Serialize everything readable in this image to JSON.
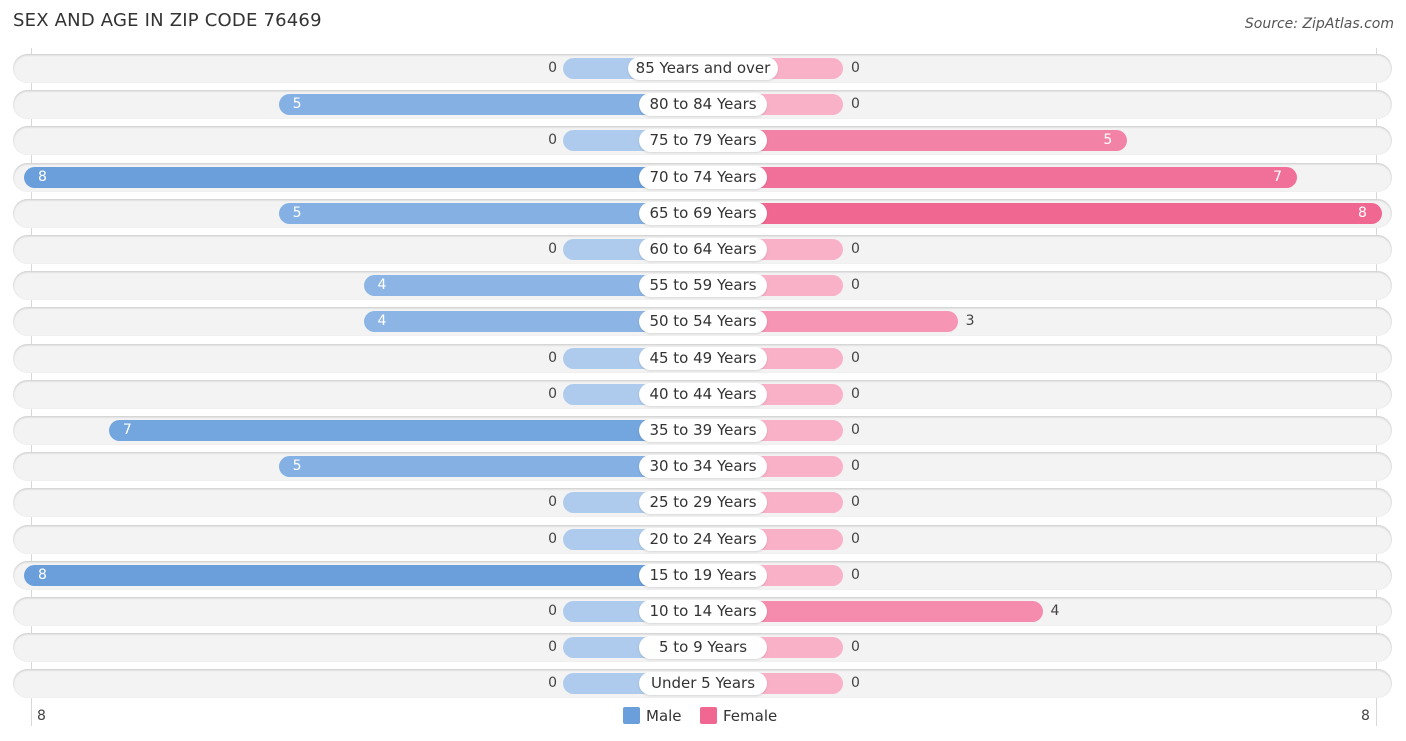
{
  "chart_data": {
    "type": "bar",
    "orientation": "horizontal-diverging",
    "title": "SEX AND AGE IN ZIP CODE 76469",
    "source": "Source: ZipAtlas.com",
    "categories": [
      "85 Years and over",
      "80 to 84 Years",
      "75 to 79 Years",
      "70 to 74 Years",
      "65 to 69 Years",
      "60 to 64 Years",
      "55 to 59 Years",
      "50 to 54 Years",
      "45 to 49 Years",
      "40 to 44 Years",
      "35 to 39 Years",
      "30 to 34 Years",
      "25 to 29 Years",
      "20 to 24 Years",
      "15 to 19 Years",
      "10 to 14 Years",
      "5 to 9 Years",
      "Under 5 Years"
    ],
    "series": [
      {
        "name": "Male",
        "color": "#6a9fdc",
        "values": [
          0,
          5,
          0,
          8,
          5,
          0,
          4,
          4,
          0,
          0,
          7,
          5,
          0,
          0,
          8,
          0,
          0,
          0
        ]
      },
      {
        "name": "Female",
        "color": "#f06792",
        "values": [
          0,
          0,
          5,
          7,
          8,
          0,
          0,
          3,
          0,
          0,
          0,
          0,
          0,
          0,
          0,
          4,
          0,
          0
        ]
      }
    ],
    "xlim": [
      -8,
      8
    ],
    "axis_labels": {
      "left": "8",
      "right": "8"
    },
    "legend": {
      "placement": "bottom-center",
      "entries": [
        "Male",
        "Female"
      ]
    },
    "grid": false
  }
}
